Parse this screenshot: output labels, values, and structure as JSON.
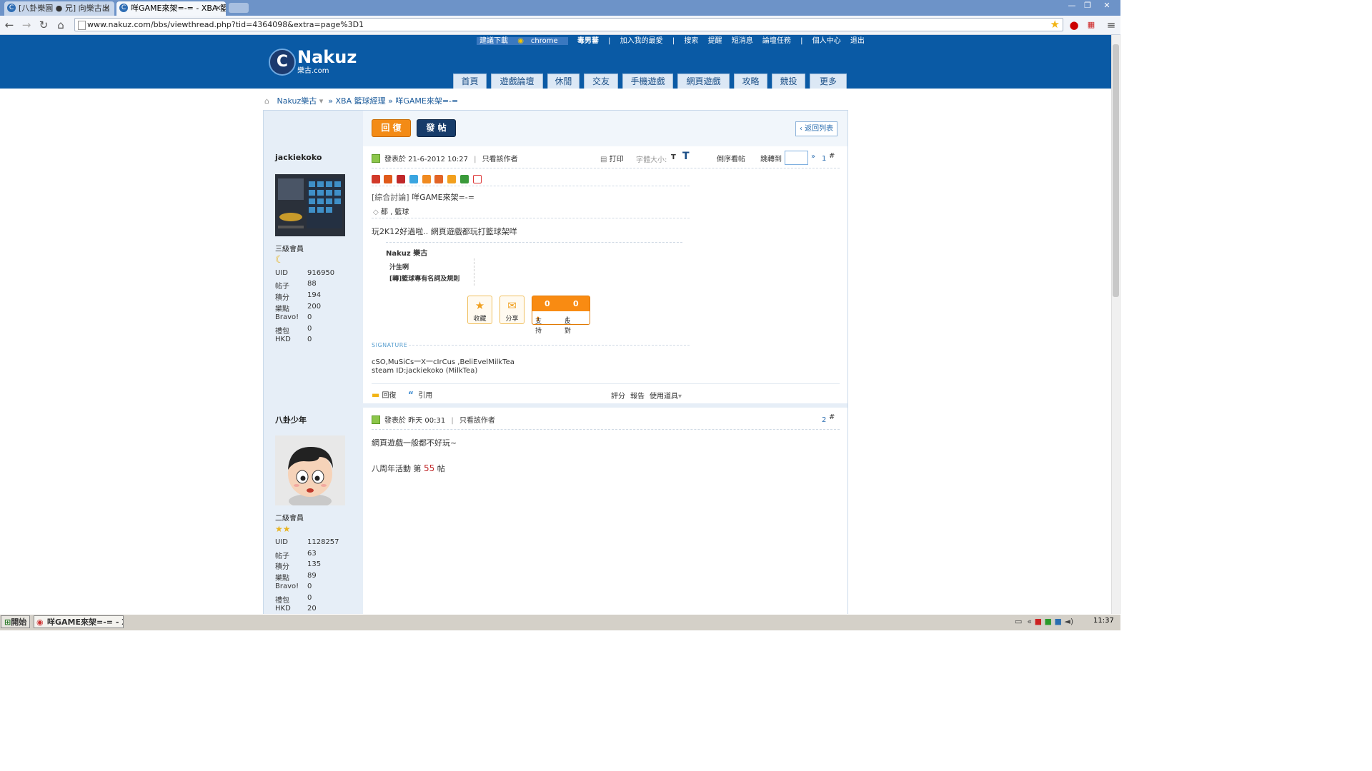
{
  "browser": {
    "tabs": [
      {
        "label": "[八卦樂園 ● 兄] 向樂古出"
      },
      {
        "label": "咩GAME來架=-= - XBA 籃"
      }
    ],
    "url": "www.nakuz.com/bbs/viewthread.php?tid=4364098&extra=page%3D1"
  },
  "site": {
    "logo_name": "Nakuz",
    "logo_sub": "樂古.com",
    "top_links": {
      "download_hint": "建議下載",
      "chrome": "chrome",
      "username": "毒男蕃",
      "favorite": "加入我的最愛",
      "search": "搜索",
      "remind": "提醒",
      "pm": "短消息",
      "tasks": "論壇任務",
      "profile": "個人中心",
      "logout": "退出"
    },
    "nav": [
      "首頁",
      "遊戲論壇",
      "休閒",
      "交友",
      "手機遊戲",
      "網頁遊戲",
      "攻略",
      "競投",
      "更多"
    ],
    "breadcrumb": {
      "home": "Nakuz樂古",
      "forum": "» XBA 籃球經理",
      "thread": "» 咩GAME來架=-="
    }
  },
  "thread": {
    "reply_button": "回 復",
    "post_button": "發 帖",
    "back_button": "返回列表",
    "print_label": "打印",
    "fontsize_label": "字體大小:",
    "font_small": "T",
    "font_big": "T",
    "reverse_label": "倒序看帖",
    "jump_label": "跳轉到",
    "jump_arrow": "»"
  },
  "posts": [
    {
      "author": "jackiekoko",
      "level": "三級會員",
      "stats": [
        [
          "UID",
          "916950"
        ],
        [
          "帖子",
          "88"
        ],
        [
          "積分",
          "194"
        ],
        [
          "樂點",
          "200"
        ],
        [
          "Bravo!",
          "0"
        ],
        [
          "禮包",
          "0"
        ],
        [
          "HKD",
          "0"
        ]
      ],
      "posted": "發表於 21-6-2012 10:27",
      "only_author": "只看該作者",
      "floor": "1",
      "hash": "#",
      "title_tag": "[綜合討論]",
      "title": "咩GAME來架=-=",
      "tags": "都 , 籃球",
      "body": "玩2K12好過啦.. 網頁遊戲都玩打籃球架咩",
      "related_title": "Nakuz 樂古",
      "related_items": [
        "汁生咧",
        "[轉]籃球專有名詞及規則"
      ],
      "collect_label": "收藏",
      "share_label": "分享",
      "support_count": "0",
      "oppose_count": "0",
      "support_label": "支持",
      "oppose_label": "反對",
      "signature_label": "SIGNATURE",
      "signature_lines": [
        "cSO,MuSiCs一X一cIrCus ,BeliEvelMilkTea",
        "steam ID:jackiekoko (MilkTea)"
      ],
      "reply_label": "回復",
      "quote_label": "引用",
      "rate_label": "評分",
      "report_label": "報告",
      "tools_label": "使用道具"
    },
    {
      "author": "八卦少年",
      "level": "二級會員",
      "stats": [
        [
          "UID",
          "1128257"
        ],
        [
          "帖子",
          "63"
        ],
        [
          "積分",
          "135"
        ],
        [
          "樂點",
          "89"
        ],
        [
          "Bravo!",
          "0"
        ],
        [
          "禮包",
          "0"
        ],
        [
          "HKD",
          "20"
        ]
      ],
      "posted": "發表於 昨天 00:31",
      "only_author": "只看該作者",
      "floor": "2",
      "hash": "#",
      "body": "網頁遊戲一般都不好玩~",
      "event_prefix": "八周年活動 第",
      "event_num": "55",
      "event_suffix": "帖"
    }
  ],
  "taskbar": {
    "start": "開始",
    "item": "咩GAME來架=-= - X...",
    "clock": "11:37"
  },
  "colors": {
    "header_blue": "#0a5aa5",
    "reply_orange": "#f38b16",
    "post_navy": "#173c6a",
    "link_blue": "#1a5a9a"
  }
}
